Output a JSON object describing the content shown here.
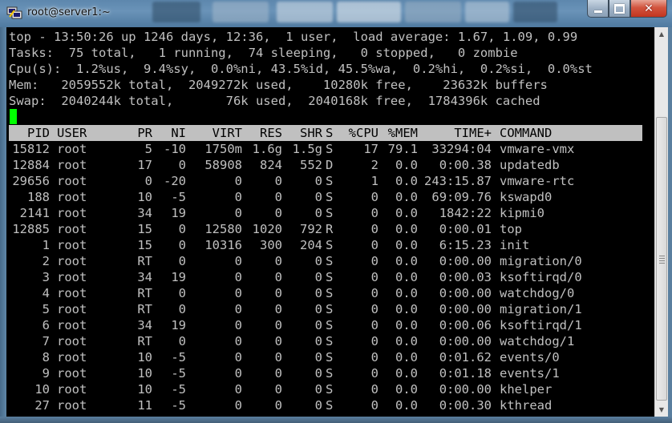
{
  "window": {
    "title": "root@server1:~"
  },
  "summary": [
    "top - 13:50:26 up 1246 days, 12:36,  1 user,  load average: 1.67, 1.09, 0.99",
    "Tasks:  75 total,   1 running,  74 sleeping,   0 stopped,   0 zombie",
    "Cpu(s):  1.2%us,  9.4%sy,  0.0%ni, 43.5%id, 45.5%wa,  0.2%hi,  0.2%si,  0.0%st",
    "Mem:   2059552k total,  2049272k used,    10280k free,    23632k buffers",
    "Swap:  2040244k total,       76k used,  2040168k free,  1784396k cached"
  ],
  "columns": [
    "PID",
    "USER",
    "PR",
    "NI",
    "VIRT",
    "RES",
    "SHR",
    "S",
    "%CPU",
    "%MEM",
    "TIME+",
    "COMMAND"
  ],
  "processes": [
    [
      "15812",
      "root",
      "5",
      "-10",
      "1750m",
      "1.6g",
      "1.5g",
      "S",
      "17",
      "79.1",
      "33294:04",
      "vmware-vmx"
    ],
    [
      "12884",
      "root",
      "17",
      "0",
      "58908",
      "824",
      "552",
      "D",
      "2",
      "0.0",
      "0:00.38",
      "updatedb"
    ],
    [
      "29656",
      "root",
      "0",
      "-20",
      "0",
      "0",
      "0",
      "S",
      "1",
      "0.0",
      "243:15.87",
      "vmware-rtc"
    ],
    [
      "188",
      "root",
      "10",
      "-5",
      "0",
      "0",
      "0",
      "S",
      "0",
      "0.0",
      "69:09.76",
      "kswapd0"
    ],
    [
      "2141",
      "root",
      "34",
      "19",
      "0",
      "0",
      "0",
      "S",
      "0",
      "0.0",
      "1842:22",
      "kipmi0"
    ],
    [
      "12885",
      "root",
      "15",
      "0",
      "12580",
      "1020",
      "792",
      "R",
      "0",
      "0.0",
      "0:00.01",
      "top"
    ],
    [
      "1",
      "root",
      "15",
      "0",
      "10316",
      "300",
      "204",
      "S",
      "0",
      "0.0",
      "6:15.23",
      "init"
    ],
    [
      "2",
      "root",
      "RT",
      "0",
      "0",
      "0",
      "0",
      "S",
      "0",
      "0.0",
      "0:00.00",
      "migration/0"
    ],
    [
      "3",
      "root",
      "34",
      "19",
      "0",
      "0",
      "0",
      "S",
      "0",
      "0.0",
      "0:00.03",
      "ksoftirqd/0"
    ],
    [
      "4",
      "root",
      "RT",
      "0",
      "0",
      "0",
      "0",
      "S",
      "0",
      "0.0",
      "0:00.00",
      "watchdog/0"
    ],
    [
      "5",
      "root",
      "RT",
      "0",
      "0",
      "0",
      "0",
      "S",
      "0",
      "0.0",
      "0:00.00",
      "migration/1"
    ],
    [
      "6",
      "root",
      "34",
      "19",
      "0",
      "0",
      "0",
      "S",
      "0",
      "0.0",
      "0:00.06",
      "ksoftirqd/1"
    ],
    [
      "7",
      "root",
      "RT",
      "0",
      "0",
      "0",
      "0",
      "S",
      "0",
      "0.0",
      "0:00.00",
      "watchdog/1"
    ],
    [
      "8",
      "root",
      "10",
      "-5",
      "0",
      "0",
      "0",
      "S",
      "0",
      "0.0",
      "0:01.62",
      "events/0"
    ],
    [
      "9",
      "root",
      "10",
      "-5",
      "0",
      "0",
      "0",
      "S",
      "0",
      "0.0",
      "0:01.18",
      "events/1"
    ],
    [
      "10",
      "root",
      "10",
      "-5",
      "0",
      "0",
      "0",
      "S",
      "0",
      "0.0",
      "0:00.00",
      "khelper"
    ],
    [
      "27",
      "root",
      "11",
      "-5",
      "0",
      "0",
      "0",
      "S",
      "0",
      "0.0",
      "0:00.30",
      "kthread"
    ]
  ],
  "colors": {
    "terminal_bg": "#000000",
    "terminal_fg": "#c0c0c0",
    "cursor": "#00ff00",
    "header_bg": "#c0c0c0",
    "close_button": "#c8452c"
  },
  "icons": {
    "app_icon": "putty-icon",
    "minimize": "minimize-icon",
    "maximize": "maximize-icon",
    "close": "close-icon"
  }
}
